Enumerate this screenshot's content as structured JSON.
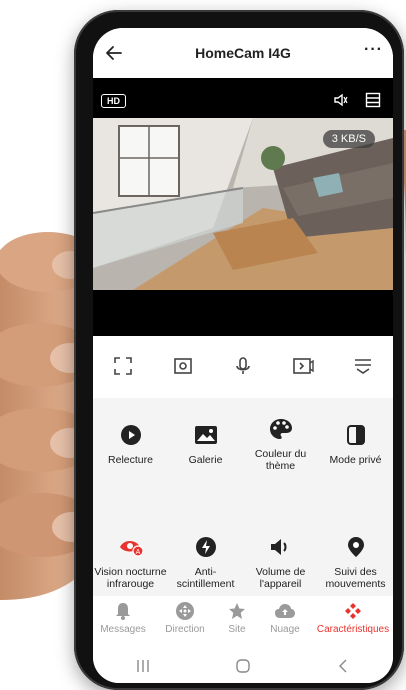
{
  "header": {
    "title": "HomeCam I4G",
    "more": "···"
  },
  "video": {
    "quality": "HD",
    "speed": "3 KB/S"
  },
  "controls": [
    {
      "icon": "fullscreen-icon"
    },
    {
      "icon": "screenshot-icon"
    },
    {
      "icon": "microphone-icon"
    },
    {
      "icon": "record-video-icon"
    },
    {
      "icon": "expand-menu-icon"
    }
  ],
  "features": [
    {
      "label": "Relecture",
      "icon": "play-icon"
    },
    {
      "label": "Galerie",
      "icon": "image-icon"
    },
    {
      "label": "Couleur du thème",
      "icon": "palette-icon"
    },
    {
      "label": "Mode privé",
      "icon": "privacy-icon"
    },
    {
      "label": "Vision nocturne infrarouge",
      "icon": "night-vision-icon"
    },
    {
      "label": "Anti-scintillement",
      "icon": "flash-icon"
    },
    {
      "label": "Volume de l'appareil",
      "icon": "speaker-icon"
    },
    {
      "label": "Suivi des mouvements",
      "icon": "location-icon"
    }
  ],
  "nav": [
    {
      "label": "Messages",
      "icon": "bell-icon"
    },
    {
      "label": "Direction",
      "icon": "dpad-icon"
    },
    {
      "label": "Site",
      "icon": "star-icon"
    },
    {
      "label": "Nuage",
      "icon": "cloud-icon"
    },
    {
      "label": "Caractéristiques",
      "icon": "features-icon",
      "active": true
    }
  ],
  "colors": {
    "accent": "#e8332f",
    "text": "#222222",
    "muted": "#9a9a9a"
  }
}
